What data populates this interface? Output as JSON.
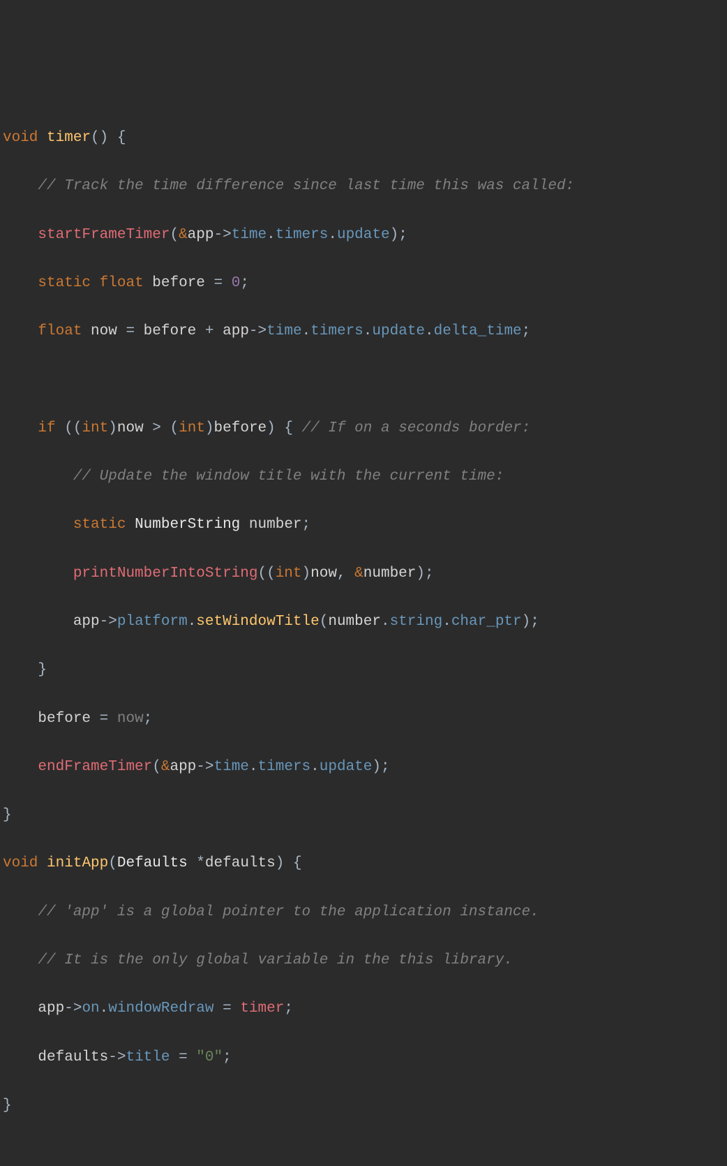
{
  "code": {
    "l1": {
      "kw1": "void",
      "fn": "timer",
      "p1": "(",
      "p2": ")",
      "brace": " {"
    },
    "l2": {
      "comment": "// Track the time difference since last time this was called:"
    },
    "l3": {
      "fn": "startFrameTimer",
      "p1": "(",
      "amp": "&",
      "var": "app",
      "arrow": "->",
      "m1": "time",
      "dot1": ".",
      "m2": "timers",
      "dot2": ".",
      "m3": "update",
      "p2": ")",
      "semi": ";"
    },
    "l4": {
      "kw1": "static",
      "kw2": "float",
      "var": "before",
      "eq": " = ",
      "num": "0",
      "semi": ";"
    },
    "l5": {
      "kw1": "float",
      "var1": "now",
      "eq": " = ",
      "var2": "before",
      "plus": " + ",
      "var3": "app",
      "arrow": "->",
      "m1": "time",
      "dot1": ".",
      "m2": "timers",
      "dot2": ".",
      "m3": "update",
      "dot3": ".",
      "m4": "delta_time",
      "semi": ";"
    },
    "l6": {
      "kw1": "if",
      "p1": " ((",
      "kw2": "int",
      "p2": ")",
      "var1": "now",
      "gt": " > ",
      "p3": "(",
      "kw3": "int",
      "p4": ")",
      "var2": "before",
      "p5": ") {",
      "comment": " // If on a seconds border:"
    },
    "l7": {
      "comment": "// Update the window title with the current time:"
    },
    "l8": {
      "kw1": "static",
      "type": "NumberString",
      "var": "number",
      "semi": ";"
    },
    "l9": {
      "fn": "printNumberIntoString",
      "p1": "((",
      "kw1": "int",
      "p2": ")",
      "var1": "now",
      "comma": ", ",
      "amp": "&",
      "var2": "number",
      "p3": ")",
      "semi": ";"
    },
    "l10": {
      "var1": "app",
      "arrow": "->",
      "m1": "platform",
      "dot1": ".",
      "fn": "setWindowTitle",
      "p1": "(",
      "var2": "number",
      "dot2": ".",
      "m2": "string",
      "dot3": ".",
      "m3": "char_ptr",
      "p2": ")",
      "semi": ";"
    },
    "l11": {
      "brace": "}"
    },
    "l12": {
      "var1": "before",
      "eq": " = ",
      "var2": "now",
      "semi": ";"
    },
    "l13": {
      "fn": "endFrameTimer",
      "p1": "(",
      "amp": "&",
      "var": "app",
      "arrow": "->",
      "m1": "time",
      "dot1": ".",
      "m2": "timers",
      "dot2": ".",
      "m3": "update",
      "p2": ")",
      "semi": ";"
    },
    "l14": {
      "brace": "}"
    },
    "l15": {
      "kw1": "void",
      "fn": "initApp",
      "p1": "(",
      "type": "Defaults",
      "star": " *",
      "param": "defaults",
      "p2": ")",
      "brace": " {"
    },
    "l16": {
      "comment": "// 'app' is a global pointer to the application instance."
    },
    "l17": {
      "comment": "// It is the only global variable in the this library."
    },
    "l18": {
      "var1": "app",
      "arrow": "->",
      "m1": "on",
      "dot1": ".",
      "m2": "windowRedraw",
      "eq": " = ",
      "var2": "timer",
      "semi": ";"
    },
    "l19": {
      "var1": "defaults",
      "arrow": "->",
      "m1": "title",
      "eq": " = ",
      "str": "\"0\"",
      "semi": ";"
    },
    "l20": {
      "brace": "}"
    }
  }
}
